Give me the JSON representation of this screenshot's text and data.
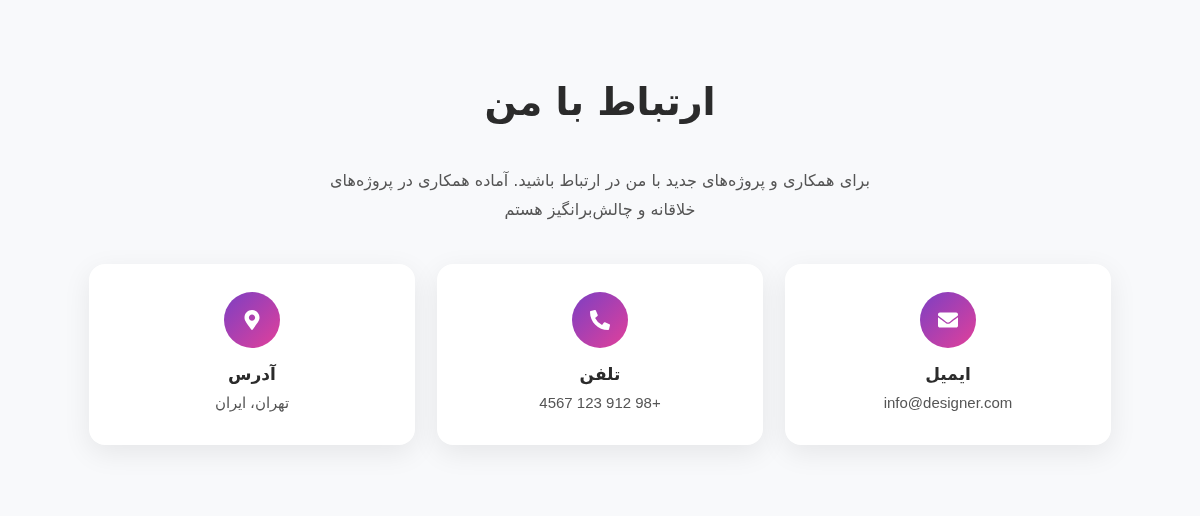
{
  "title": "ارتباط با من",
  "subtitle": "برای همکاری و پروژه‌های جدید با من در ارتباط باشید. آماده همکاری در پروژه‌های خلاقانه و چالش‌برانگیز هستم",
  "cards": [
    {
      "kind": "email",
      "label": "ایمیل",
      "value": "info@designer.com"
    },
    {
      "kind": "phone",
      "label": "تلفن",
      "value": "+98 912 123 4567"
    },
    {
      "kind": "address",
      "label": "آدرس",
      "value": "تهران، ایران"
    }
  ]
}
